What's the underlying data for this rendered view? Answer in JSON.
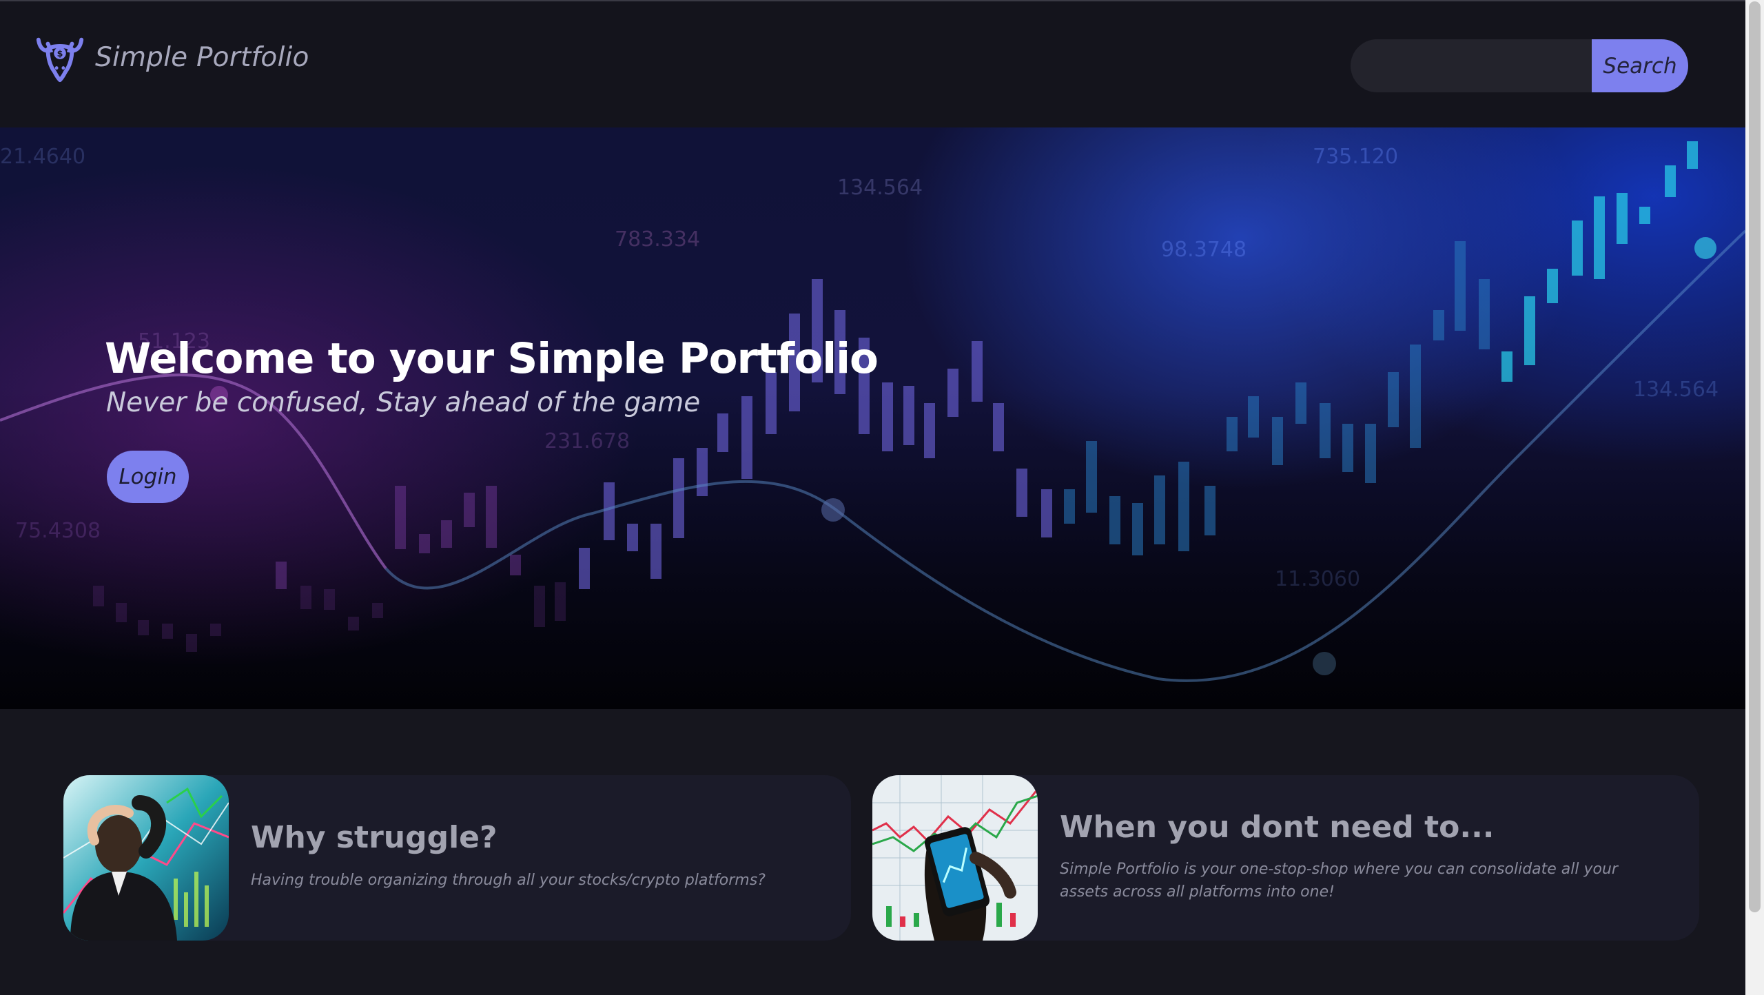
{
  "header": {
    "brand_name": "Simple Portfolio",
    "logo_icon": "bull-dollar-icon",
    "search": {
      "placeholder": "",
      "value": "",
      "button_label": "Search"
    }
  },
  "hero": {
    "title": "Welcome to your Simple Portfolio",
    "subtitle": "Never be confused, Stay ahead of the game",
    "login_label": "Login",
    "background_numbers": [
      "735.120",
      "134.564",
      "783.334",
      "98.3748",
      "231.678",
      "75.4308",
      "11.3060",
      "134.564",
      "21.4640",
      "51.123"
    ]
  },
  "cards": [
    {
      "title": "Why struggle?",
      "text": "Having trouble organizing through all your stocks/crypto platforms?",
      "image": "stressed-businessman-image"
    },
    {
      "title": "When you dont need to...",
      "text": "Simple Portfolio is your one-stop-shop where you can consolidate all your assets across all platforms into one!",
      "image": "phone-trading-chart-image"
    }
  ],
  "colors": {
    "accent": "#7d80ee",
    "page_background": "#16161e",
    "header_background": "#14141c",
    "card_background": "#1b1b29"
  }
}
